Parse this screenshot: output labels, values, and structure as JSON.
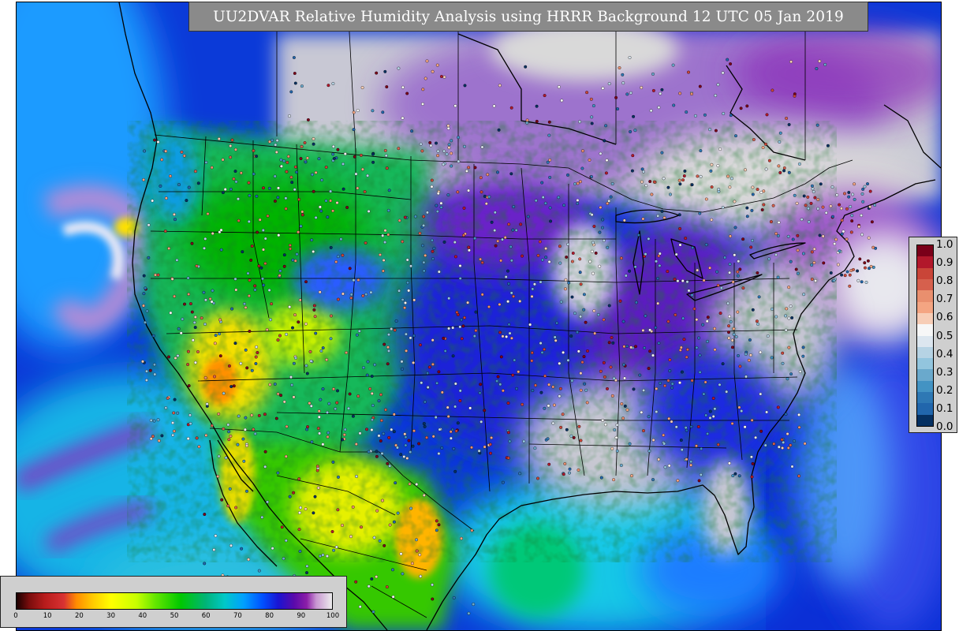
{
  "map": {
    "title": "UU2DVAR Relative Humidity Analysis using HRRR Background 12 UTC 05 Jan 2019",
    "variable": "Relative Humidity",
    "background_model": "HRRR",
    "valid_time": "12 UTC 05 Jan 2019",
    "region": "CONUS",
    "layers": [
      "relative-humidity-field",
      "coastlines",
      "state-borders",
      "country-borders",
      "observation-stations"
    ]
  },
  "rh_colorbar": {
    "orientation": "horizontal",
    "min": 0,
    "max": 100,
    "ticks": [
      "0",
      "10",
      "20",
      "30",
      "40",
      "50",
      "60",
      "70",
      "80",
      "90",
      "100"
    ],
    "colors": [
      {
        "stop": 0,
        "color": "#1a0000"
      },
      {
        "stop": 4,
        "color": "#7a0d0d"
      },
      {
        "stop": 9,
        "color": "#b81c1c"
      },
      {
        "stop": 15,
        "color": "#d83232"
      },
      {
        "stop": 19,
        "color": "#ff8c00"
      },
      {
        "stop": 24,
        "color": "#ffc800"
      },
      {
        "stop": 30,
        "color": "#ffff00"
      },
      {
        "stop": 38,
        "color": "#c8ff00"
      },
      {
        "stop": 44,
        "color": "#64e600"
      },
      {
        "stop": 52,
        "color": "#00c800"
      },
      {
        "stop": 60,
        "color": "#00b478"
      },
      {
        "stop": 66,
        "color": "#00c8c8"
      },
      {
        "stop": 72,
        "color": "#00a0ff"
      },
      {
        "stop": 78,
        "color": "#0050ff"
      },
      {
        "stop": 83,
        "color": "#1a14d2"
      },
      {
        "stop": 88,
        "color": "#5a0aaa"
      },
      {
        "stop": 92,
        "color": "#8c1ea8"
      },
      {
        "stop": 95,
        "color": "#c896d2"
      },
      {
        "stop": 100,
        "color": "#ececec"
      }
    ]
  },
  "obs_colorbar": {
    "orientation": "vertical",
    "min": 0.0,
    "max": 1.0,
    "ticks": [
      "1.0",
      "0.9",
      "0.8",
      "0.7",
      "0.6",
      "0.5",
      "0.4",
      "0.3",
      "0.2",
      "0.1",
      "0.0"
    ],
    "colors": [
      "#7a0019",
      "#b2182b",
      "#c94538",
      "#d6604d",
      "#e98f6e",
      "#f4a582",
      "#f7cdb6",
      "#f7f7f7",
      "#dce6ef",
      "#b6d3e4",
      "#92c5de",
      "#6aa9cc",
      "#4393c3",
      "#2e78b4",
      "#2166ac",
      "#053061"
    ]
  },
  "colors": {
    "ocean_moist": "#0a2fe0",
    "saturated": "#d9d9d9",
    "panel_gray": "#cfcfcf",
    "banner_gray": "#8a8a8a"
  }
}
